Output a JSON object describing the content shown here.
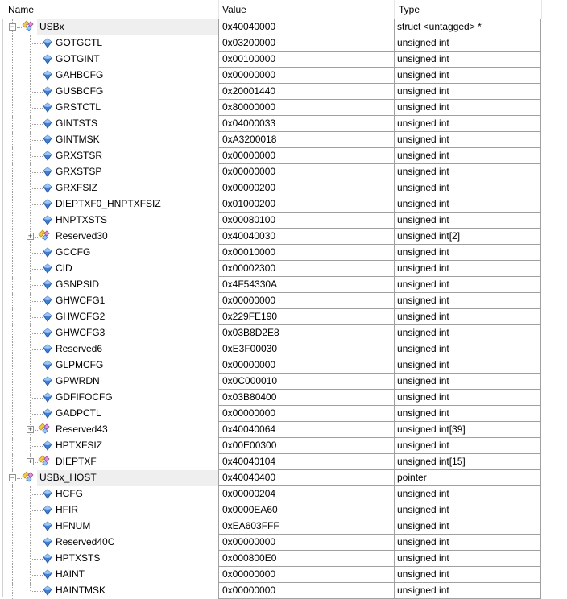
{
  "header": {
    "name": "Name",
    "value": "Value",
    "type": "Type"
  },
  "rows": [
    {
      "name": "USBx",
      "value": "0x40040000",
      "type": "struct <untagged> *",
      "kind": "struct",
      "level": 0,
      "expanded": true
    },
    {
      "name": "GOTGCTL",
      "value": "0x03200000",
      "type": "unsigned int",
      "kind": "field",
      "level": 1
    },
    {
      "name": "GOTGINT",
      "value": "0x00100000",
      "type": "unsigned int",
      "kind": "field",
      "level": 1
    },
    {
      "name": "GAHBCFG",
      "value": "0x00000000",
      "type": "unsigned int",
      "kind": "field",
      "level": 1
    },
    {
      "name": "GUSBCFG",
      "value": "0x20001440",
      "type": "unsigned int",
      "kind": "field",
      "level": 1
    },
    {
      "name": "GRSTCTL",
      "value": "0x80000000",
      "type": "unsigned int",
      "kind": "field",
      "level": 1
    },
    {
      "name": "GINTSTS",
      "value": "0x04000033",
      "type": "unsigned int",
      "kind": "field",
      "level": 1
    },
    {
      "name": "GINTMSK",
      "value": "0xA3200018",
      "type": "unsigned int",
      "kind": "field",
      "level": 1
    },
    {
      "name": "GRXSTSR",
      "value": "0x00000000",
      "type": "unsigned int",
      "kind": "field",
      "level": 1
    },
    {
      "name": "GRXSTSP",
      "value": "0x00000000",
      "type": "unsigned int",
      "kind": "field",
      "level": 1
    },
    {
      "name": "GRXFSIZ",
      "value": "0x00000200",
      "type": "unsigned int",
      "kind": "field",
      "level": 1
    },
    {
      "name": "DIEPTXF0_HNPTXFSIZ",
      "value": "0x01000200",
      "type": "unsigned int",
      "kind": "field",
      "level": 1
    },
    {
      "name": "HNPTXSTS",
      "value": "0x00080100",
      "type": "unsigned int",
      "kind": "field",
      "level": 1
    },
    {
      "name": "Reserved30",
      "value": "0x40040030",
      "type": "unsigned int[2]",
      "kind": "struct",
      "level": 1,
      "expanded": false
    },
    {
      "name": "GCCFG",
      "value": "0x00010000",
      "type": "unsigned int",
      "kind": "field",
      "level": 1
    },
    {
      "name": "CID",
      "value": "0x00002300",
      "type": "unsigned int",
      "kind": "field",
      "level": 1
    },
    {
      "name": "GSNPSID",
      "value": "0x4F54330A",
      "type": "unsigned int",
      "kind": "field",
      "level": 1
    },
    {
      "name": "GHWCFG1",
      "value": "0x00000000",
      "type": "unsigned int",
      "kind": "field",
      "level": 1
    },
    {
      "name": "GHWCFG2",
      "value": "0x229FE190",
      "type": "unsigned int",
      "kind": "field",
      "level": 1
    },
    {
      "name": "GHWCFG3",
      "value": "0x03B8D2E8",
      "type": "unsigned int",
      "kind": "field",
      "level": 1
    },
    {
      "name": "Reserved6",
      "value": "0xE3F00030",
      "type": "unsigned int",
      "kind": "field",
      "level": 1
    },
    {
      "name": "GLPMCFG",
      "value": "0x00000000",
      "type": "unsigned int",
      "kind": "field",
      "level": 1
    },
    {
      "name": "GPWRDN",
      "value": "0x0C000010",
      "type": "unsigned int",
      "kind": "field",
      "level": 1
    },
    {
      "name": "GDFIFOCFG",
      "value": "0x03B80400",
      "type": "unsigned int",
      "kind": "field",
      "level": 1
    },
    {
      "name": "GADPCTL",
      "value": "0x00000000",
      "type": "unsigned int",
      "kind": "field",
      "level": 1
    },
    {
      "name": "Reserved43",
      "value": "0x40040064",
      "type": "unsigned int[39]",
      "kind": "struct",
      "level": 1,
      "expanded": false
    },
    {
      "name": "HPTXFSIZ",
      "value": "0x00E00300",
      "type": "unsigned int",
      "kind": "field",
      "level": 1
    },
    {
      "name": "DIEPTXF",
      "value": "0x40040104",
      "type": "unsigned int[15]",
      "kind": "struct",
      "level": 1,
      "expanded": false
    },
    {
      "name": "USBx_HOST",
      "value": "0x40040400",
      "type": "pointer",
      "kind": "struct",
      "level": 0,
      "expanded": true
    },
    {
      "name": "HCFG",
      "value": "0x00000204",
      "type": "unsigned int",
      "kind": "field",
      "level": 1
    },
    {
      "name": "HFIR",
      "value": "0x0000EA60",
      "type": "unsigned int",
      "kind": "field",
      "level": 1
    },
    {
      "name": "HFNUM",
      "value": "0xEA603FFF",
      "type": "unsigned int",
      "kind": "field",
      "level": 1
    },
    {
      "name": "Reserved40C",
      "value": "0x00000000",
      "type": "unsigned int",
      "kind": "field",
      "level": 1
    },
    {
      "name": "HPTXSTS",
      "value": "0x000800E0",
      "type": "unsigned int",
      "kind": "field",
      "level": 1
    },
    {
      "name": "HAINT",
      "value": "0x00000000",
      "type": "unsigned int",
      "kind": "field",
      "level": 1
    },
    {
      "name": "HAINTMSK",
      "value": "0x00000000",
      "type": "unsigned int",
      "kind": "field",
      "level": 1
    }
  ]
}
